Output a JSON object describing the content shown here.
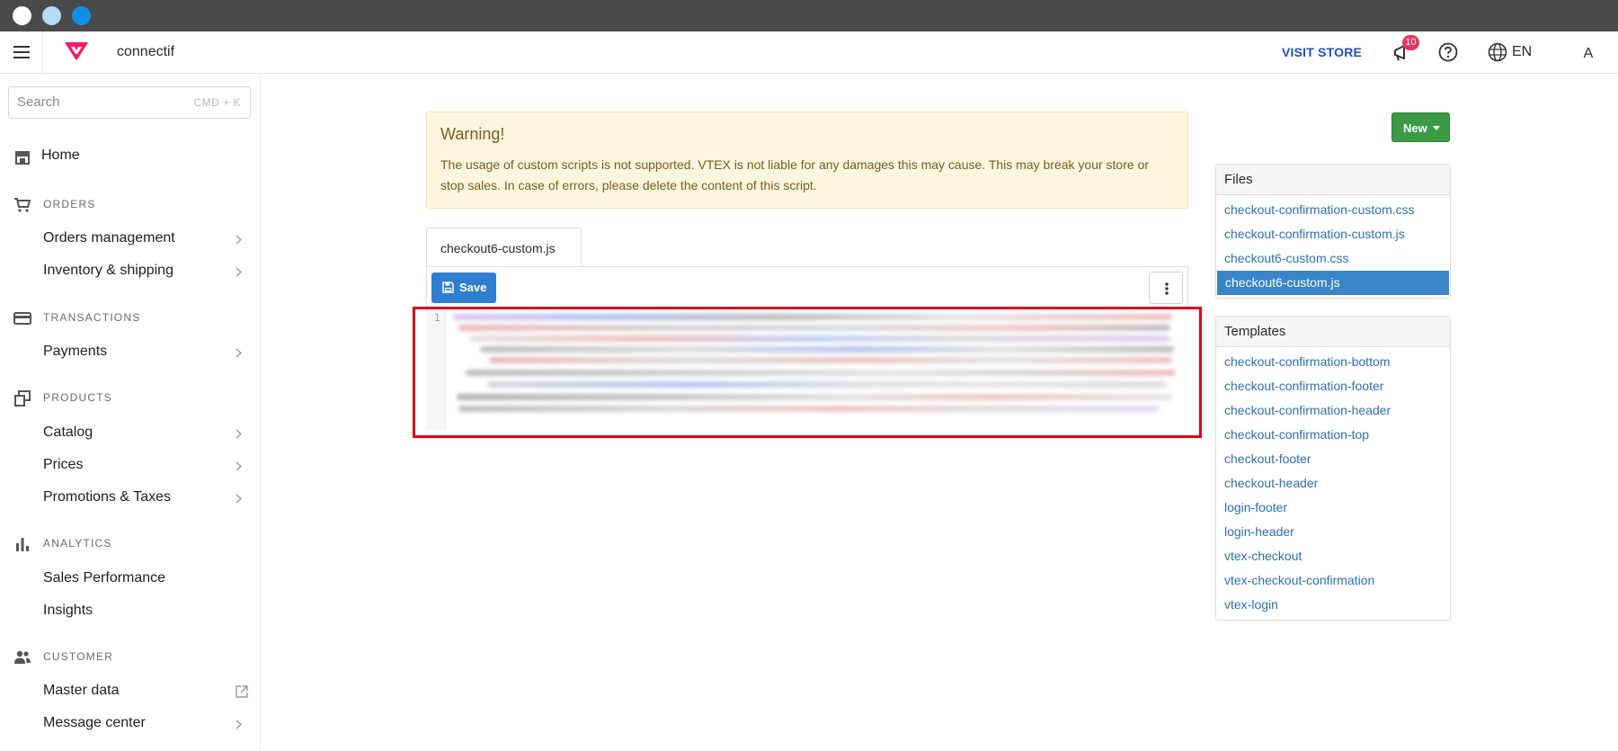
{
  "header": {
    "store_name": "connectif",
    "visit_store": "VISIT STORE",
    "notification_count": "10",
    "language": "EN",
    "avatar_initial": "A"
  },
  "sidebar": {
    "search_placeholder": "Search",
    "search_shortcut": "CMD + K",
    "home": "Home",
    "sections": {
      "orders": "ORDERS",
      "transactions": "TRANSACTIONS",
      "products": "PRODUCTS",
      "analytics": "ANALYTICS",
      "customer": "CUSTOMER"
    },
    "items": {
      "orders_management": "Orders management",
      "inventory_shipping": "Inventory & shipping",
      "payments": "Payments",
      "catalog": "Catalog",
      "prices": "Prices",
      "promotions_taxes": "Promotions & Taxes",
      "sales_performance": "Sales Performance",
      "insights": "Insights",
      "master_data": "Master data",
      "message_center": "Message center"
    }
  },
  "main": {
    "warning_title": "Warning!",
    "warning_text": "The usage of custom scripts is not supported. VTEX is not liable for any damages this may cause. This may break your store or stop sales. In case of errors, please delete the content of this script.",
    "file_tab": "checkout6-custom.js",
    "save_label": "Save",
    "line_number": "1"
  },
  "right": {
    "new_label": "New",
    "files_title": "Files",
    "files": [
      "checkout-confirmation-custom.css",
      "checkout-confirmation-custom.js",
      "checkout6-custom.css",
      "checkout6-custom.js"
    ],
    "active_file": "checkout6-custom.js",
    "templates_title": "Templates",
    "templates": [
      "checkout-confirmation-bottom",
      "checkout-confirmation-footer",
      "checkout-confirmation-header",
      "checkout-confirmation-top",
      "checkout-footer",
      "checkout-header",
      "login-footer",
      "login-header",
      "vtex-checkout",
      "vtex-checkout-confirmation",
      "vtex-login"
    ]
  },
  "colors": {
    "accent_blue": "#2f7fd1",
    "active_file_bg": "#3a84c9",
    "new_button": "#3c9a44",
    "highlight_red": "#e00016",
    "warning_bg": "#fdf6df",
    "badge": "#e2345a"
  }
}
